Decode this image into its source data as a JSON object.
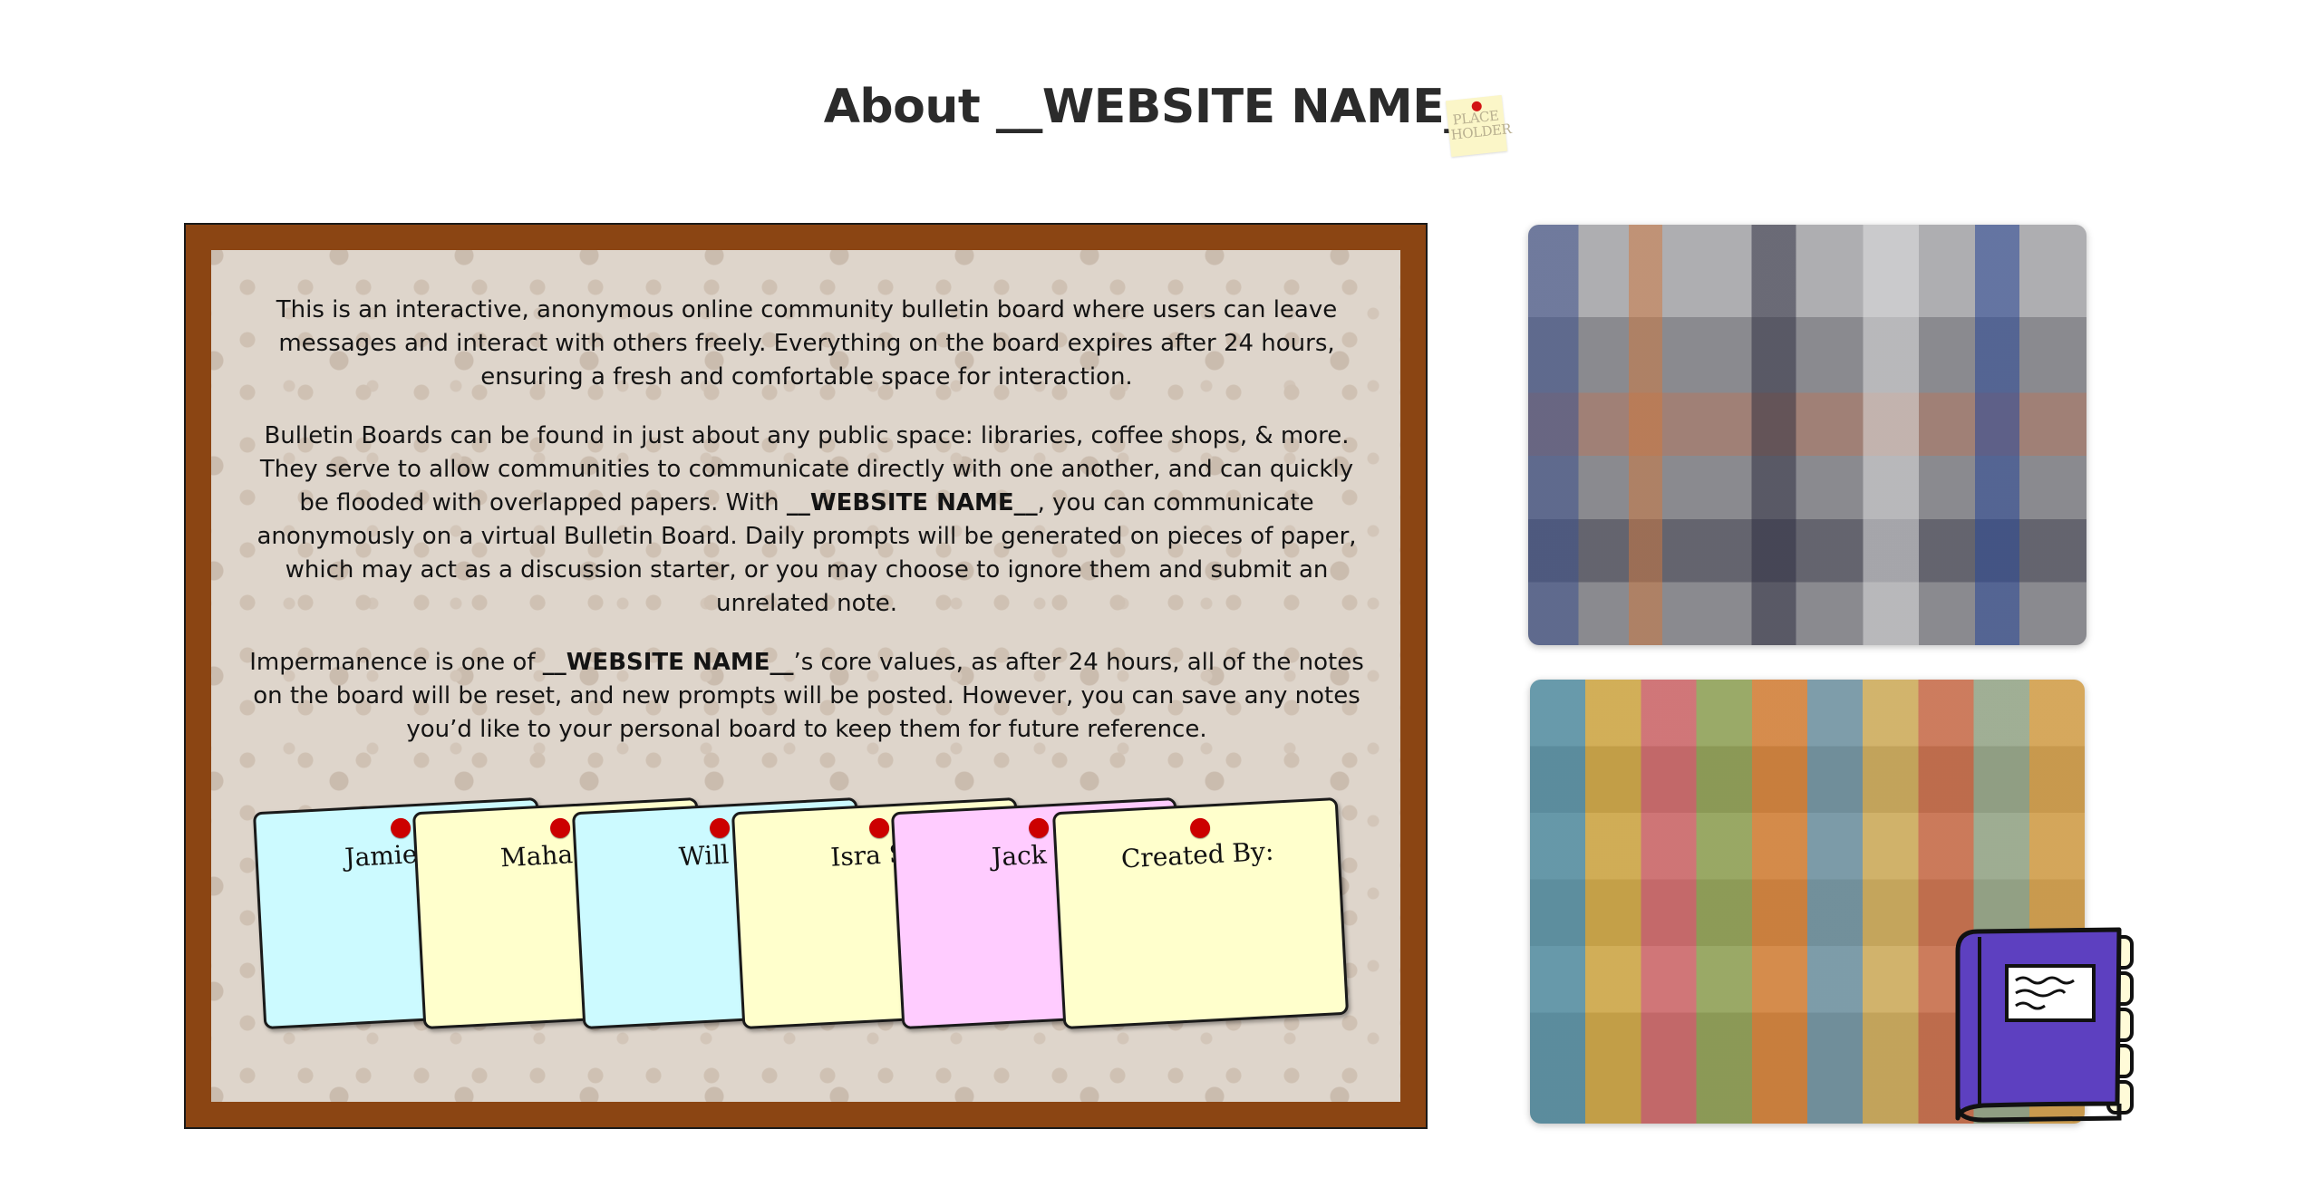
{
  "page": {
    "title": "About __WEBSITE NAME__",
    "placeholder_sticker": "PLACE HOLDER"
  },
  "about": {
    "p1": "This is an interactive, anonymous online community bulletin board where users can leave messages and interact with others freely. Everything on the board expires after 24 hours, ensuring a fresh and comfortable space for interaction.",
    "p2_before": "Bulletin Boards can be found in just about any public space: libraries, coffee shops, & more. They serve to allow communities to communicate directly with one another, and can quickly be flooded with overlapped papers. With ",
    "p2_bold": "__WEBSITE NAME__",
    "p2_after": ", you can communicate anonymously on a virtual Bulletin Board. Daily prompts will be generated on pieces of paper, which may act as a discussion starter, or you may choose to ignore them and submit an unrelated note.",
    "p3_before": "Impermanence is one of ",
    "p3_bold": "__WEBSITE NAME__",
    "p3_after": "’s core values, as after 24 hours, all of the notes on the board will be reset, and new prompts will be posted. However, you can save any notes you’d like to your personal board to keep them for future reference."
  },
  "notes": [
    {
      "name": "Jamie M",
      "color": "#ccfaff"
    },
    {
      "name": "Maha Sh",
      "color": "#ffffcc"
    },
    {
      "name": "Will A",
      "color": "#ccfaff"
    },
    {
      "name": "Isra Sh",
      "color": "#ffffcc"
    },
    {
      "name": "Jack M",
      "color": "#ffccff"
    },
    {
      "name": "Created By:",
      "color": "#ffffcc"
    }
  ],
  "colors": {
    "frame": "#8b4513",
    "cork": "#ded5cb",
    "pin": "#cc0000",
    "notebook": "#5d40c0"
  },
  "icons": {
    "notebook": "notebook-icon"
  }
}
